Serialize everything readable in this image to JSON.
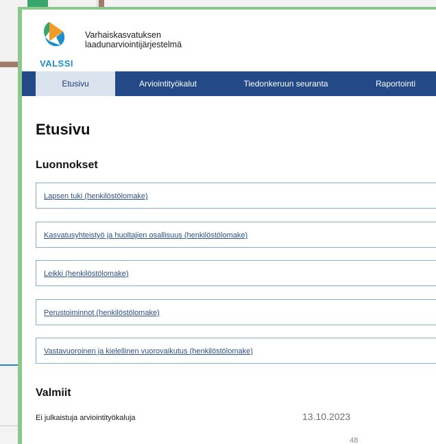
{
  "app": {
    "logo_text": "VALSSI",
    "title_line1": "Varhaiskasvatuksen",
    "title_line2": "laadunarviointijärjestelmä"
  },
  "nav": {
    "tabs": [
      {
        "label": "Etusivu",
        "active": true
      },
      {
        "label": "Arviointityökalut",
        "active": false
      },
      {
        "label": "Tiedonkeruun seuranta",
        "active": false
      },
      {
        "label": "Raportointi",
        "active": false
      }
    ]
  },
  "page": {
    "title": "Etusivu"
  },
  "drafts": {
    "heading": "Luonnokset",
    "items": [
      {
        "label": "Lapsen tuki (henkilöstölomake)"
      },
      {
        "label": "Kasvatusyhteistyö ja huoltajien osallisuus (henkilöstölomake)"
      },
      {
        "label": "Leikki (henkilöstölomake)"
      },
      {
        "label": "Perustoiminnot (henkilöstölomake)"
      },
      {
        "label": "Vastavuoroinen ja kielellinen vuorovaikutus (henkilöstölomake)"
      }
    ]
  },
  "ready": {
    "heading": "Valmiit",
    "empty_text": "Ei julkaistuja arviointityökaluja"
  },
  "slide": {
    "date": "13.10.2023",
    "page_number": "48"
  },
  "colors": {
    "nav_bg": "#234a86",
    "nav_active_bg": "#dbe3ef",
    "frame_green": "#8cc88e",
    "link": "#2c4f86",
    "logo_blue": "#1b8fc8"
  }
}
